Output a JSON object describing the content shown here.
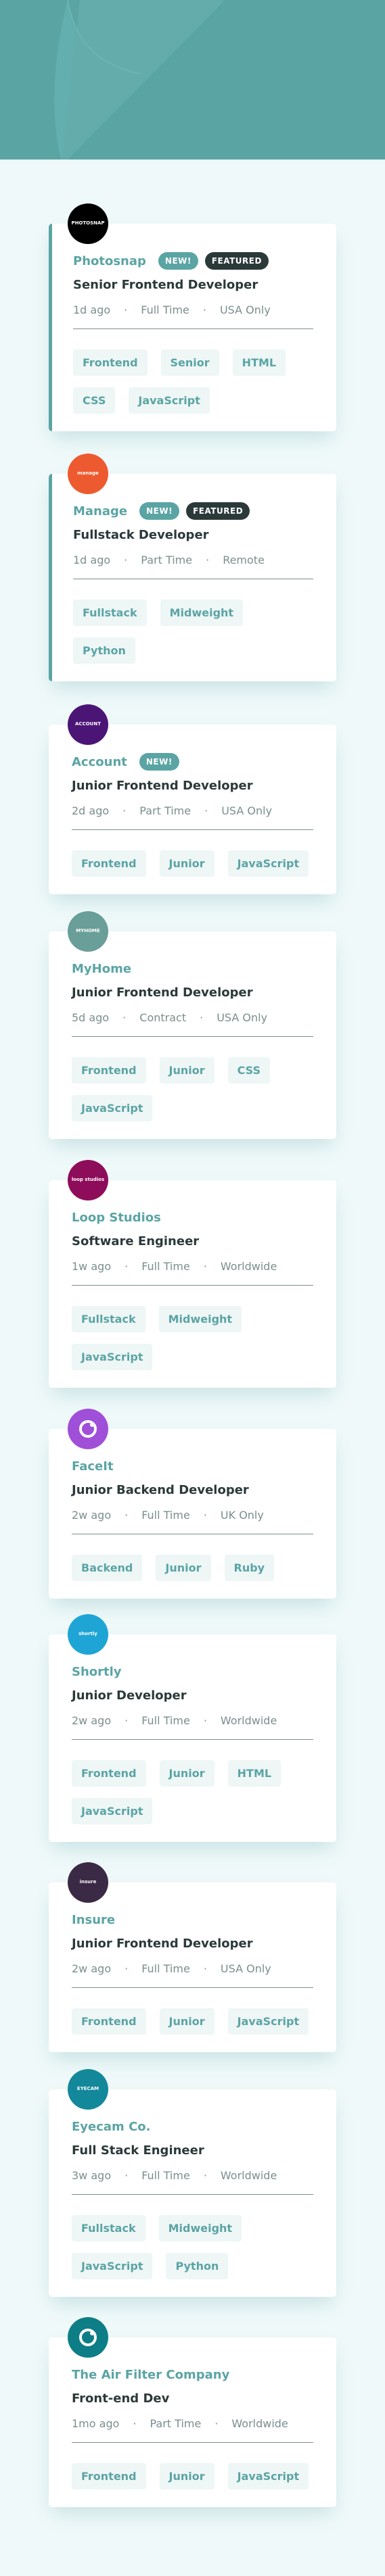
{
  "jobs": [
    {
      "company": "Photosnap",
      "new_label": "NEW!",
      "featured_label": "FEATURED",
      "position": "Senior Frontend Developer",
      "posted": "1d ago",
      "contract": "Full Time",
      "location": "USA Only",
      "tags": [
        "Frontend",
        "Senior",
        "HTML",
        "CSS",
        "JavaScript"
      ],
      "logo_text": "PHOTOSNAP",
      "logo_color": "#000000"
    },
    {
      "company": "Manage",
      "new_label": "NEW!",
      "featured_label": "FEATURED",
      "position": "Fullstack Developer",
      "posted": "1d ago",
      "contract": "Part Time",
      "location": "Remote",
      "tags": [
        "Fullstack",
        "Midweight",
        "Python"
      ],
      "logo_text": "manage",
      "logo_color": "#ee5a2f"
    },
    {
      "company": "Account",
      "new_label": "NEW!",
      "featured_label": "",
      "position": "Junior Frontend Developer",
      "posted": "2d ago",
      "contract": "Part Time",
      "location": "USA Only",
      "tags": [
        "Frontend",
        "Junior",
        "JavaScript"
      ],
      "logo_text": "ACCOUNT",
      "logo_color": "#4b1576"
    },
    {
      "company": "MyHome",
      "new_label": "",
      "featured_label": "",
      "position": "Junior Frontend Developer",
      "posted": "5d ago",
      "contract": "Contract",
      "location": "USA Only",
      "tags": [
        "Frontend",
        "Junior",
        "CSS",
        "JavaScript"
      ],
      "logo_text": "MYHOME",
      "logo_color": "#6a9e98"
    },
    {
      "company": "Loop Studios",
      "new_label": "",
      "featured_label": "",
      "position": "Software Engineer",
      "posted": "1w ago",
      "contract": "Full Time",
      "location": "Worldwide",
      "tags": [
        "Fullstack",
        "Midweight",
        "JavaScript"
      ],
      "logo_text": "loop studios",
      "logo_color": "#8e0d5a"
    },
    {
      "company": "FaceIt",
      "new_label": "",
      "featured_label": "",
      "position": "Junior Backend Developer",
      "posted": "2w ago",
      "contract": "Full Time",
      "location": "UK Only",
      "tags": [
        "Backend",
        "Junior",
        "Ruby"
      ],
      "logo_text": "",
      "logo_color": "#a04fd9"
    },
    {
      "company": "Shortly",
      "new_label": "",
      "featured_label": "",
      "position": "Junior Developer",
      "posted": "2w ago",
      "contract": "Full Time",
      "location": "Worldwide",
      "tags": [
        "Frontend",
        "Junior",
        "HTML",
        "JavaScript"
      ],
      "logo_text": "shortly",
      "logo_color": "#1ea5d5"
    },
    {
      "company": "Insure",
      "new_label": "",
      "featured_label": "",
      "position": "Junior Frontend Developer",
      "posted": "2w ago",
      "contract": "Full Time",
      "location": "USA Only",
      "tags": [
        "Frontend",
        "Junior",
        "JavaScript"
      ],
      "logo_text": "insure",
      "logo_color": "#3b2a45"
    },
    {
      "company": "Eyecam Co.",
      "new_label": "",
      "featured_label": "",
      "position": "Full Stack Engineer",
      "posted": "3w ago",
      "contract": "Full Time",
      "location": "Worldwide",
      "tags": [
        "Fullstack",
        "Midweight",
        "JavaScript",
        "Python"
      ],
      "logo_text": "EYECAM",
      "logo_color": "#13889a"
    },
    {
      "company": "The Air Filter Company",
      "new_label": "",
      "featured_label": "",
      "position": "Front-end Dev",
      "posted": "1mo ago",
      "contract": "Part Time",
      "location": "Worldwide",
      "tags": [
        "Frontend",
        "Junior",
        "JavaScript"
      ],
      "logo_text": "",
      "logo_color": "#0e7e86"
    }
  ],
  "meta_separator": "·"
}
